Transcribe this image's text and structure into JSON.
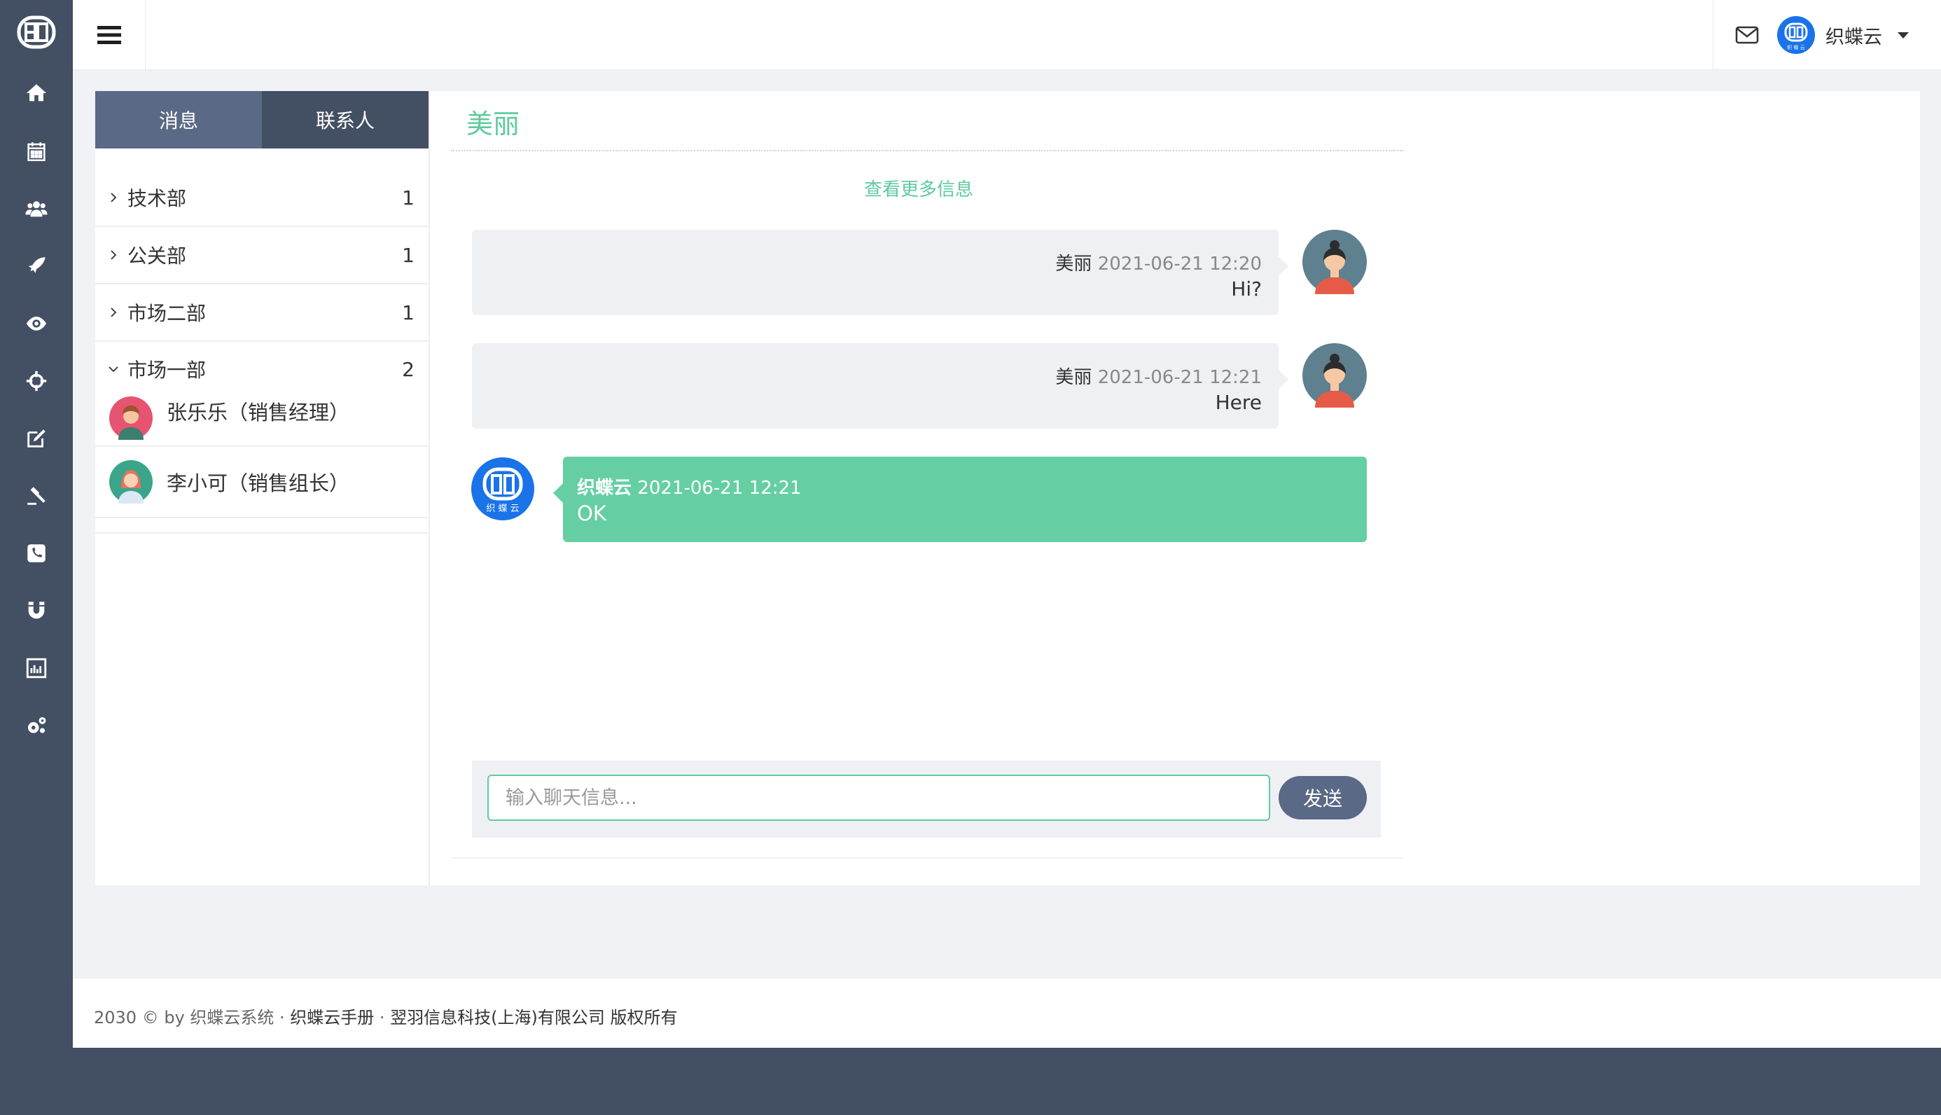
{
  "brand": {
    "accent": "#5ecb9e",
    "sidebar_bg": "#434f63",
    "tab_active": "#5a6985",
    "bubble_out": "#65cfa3"
  },
  "nav": {
    "icons": [
      "logo-icon",
      "home-icon",
      "calendar-icon",
      "users-icon",
      "rocket-icon",
      "eye-icon",
      "crosshair-icon",
      "edit-icon",
      "gavel-icon",
      "phone-icon",
      "magnet-icon",
      "bar-chart-icon",
      "cogs-icon"
    ]
  },
  "header": {
    "user_name": "织蝶云"
  },
  "contacts": {
    "tabs": [
      {
        "label": "消息",
        "active": true
      },
      {
        "label": "联系人",
        "active": false
      }
    ],
    "groups": [
      {
        "name": "技术部",
        "count": "1",
        "expanded": false
      },
      {
        "name": "公关部",
        "count": "1",
        "expanded": false
      },
      {
        "name": "市场二部",
        "count": "1",
        "expanded": false
      },
      {
        "name": "市场一部",
        "count": "2",
        "expanded": true
      }
    ],
    "members": [
      {
        "name": "张乐乐（销售经理）"
      },
      {
        "name": "李小可（销售组长）"
      }
    ]
  },
  "chat": {
    "title": "美丽",
    "more_link": "查看更多信息",
    "messages": [
      {
        "sender": "美丽",
        "time": "2021-06-21 12:20",
        "text": "Hi?",
        "direction": "in"
      },
      {
        "sender": "美丽",
        "time": "2021-06-21 12:21",
        "text": "Here",
        "direction": "in"
      },
      {
        "sender": "织蝶云",
        "time": "2021-06-21 12:21",
        "text": "OK",
        "direction": "out"
      }
    ],
    "input_placeholder": "输入聊天信息...",
    "input_value": "",
    "send_label": "发送"
  },
  "footer": {
    "prefix": "2030 © by 织蝶云系统 · ",
    "manual_link": "织蝶云手册",
    "separator": " · ",
    "company": "翌羽信息科技(上海)有限公司 版权所有"
  }
}
